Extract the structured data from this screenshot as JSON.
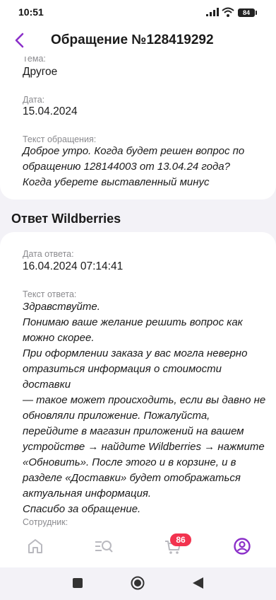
{
  "status_bar": {
    "time": "10:51",
    "battery": "84"
  },
  "header": {
    "title": "Обращение №128419292"
  },
  "appeal": {
    "topic_label": "Тема:",
    "topic_value": "Другое",
    "date_label": "Дата:",
    "date_value": "15.04.2024",
    "text_label": "Текст обращения:",
    "text_value": "Доброе утро. Когда будет решен вопрос по\nобращению 128144003 от 13.04.24 года?\nКогда уберете выставленный минус"
  },
  "response_section_title": "Ответ Wildberries",
  "response": {
    "date_label": "Дата ответа:",
    "date_value": "16.04.2024 07:14:41",
    "text_label": "Текст ответа:",
    "text_value": "Здравствуйте.\nПонимаю ваше желание решить вопрос как\nможно скорее.\nПри оформлении заказа у вас могла неверно\nотразиться информация о стоимости доставки\n— такое может происходить, если вы давно не\nобновляли приложение. Пожалуйста,\nперейдите в магазин приложений на вашем\nустройстве → найдите Wildberries → нажмите\n«Обновить». После этого и в корзине, и в\nразделе «Доставки» будет отображаться\nактуальная информация.\nСпасибо за обращение.",
    "employee_label": "Сотрудник:"
  },
  "tab_bar": {
    "cart_badge": "86",
    "accent_color": "#8b2fc9",
    "icons": [
      "home-icon",
      "catalog-search-icon",
      "cart-icon",
      "profile-icon"
    ]
  },
  "system_nav": {
    "icons": [
      "recents-square-icon",
      "home-circle-icon",
      "back-triangle-icon"
    ]
  }
}
